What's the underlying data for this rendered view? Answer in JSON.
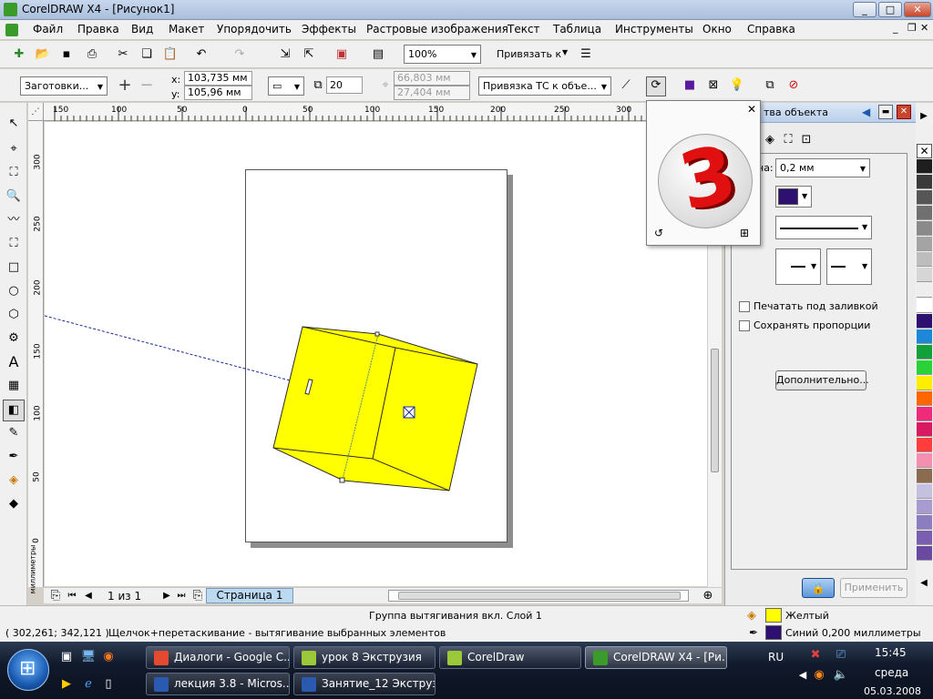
{
  "window": {
    "title": "CorelDRAW X4 - [Рисунок1]",
    "controls": [
      "_",
      "□",
      "✕"
    ]
  },
  "menu": [
    "Файл",
    "Правка",
    "Вид",
    "Макет",
    "Упорядочить",
    "Эффекты",
    "Растровые изображения",
    "Текст",
    "Таблица",
    "Инструменты",
    "Окно",
    "Справка"
  ],
  "toolbar_std": {
    "zoom": "100%",
    "snap_label": "Привязать к"
  },
  "propbar": {
    "presets": "Заготовки...",
    "x_label": "x:",
    "x_value": "103,735 мм",
    "y_label": "y:",
    "y_value": "105,96 мм",
    "depth": "20",
    "vp_x": "66,803 мм",
    "vp_y": "27,404 мм",
    "vp_lock": "Привязка ТС к объе..."
  },
  "ruler": {
    "h_labels": [
      "150",
      "100",
      "50",
      "0",
      "50",
      "100",
      "150",
      "200",
      "250",
      "300"
    ],
    "v_labels": [
      "300",
      "250",
      "200",
      "150",
      "100",
      "50",
      "0"
    ],
    "units": "миллиметры"
  },
  "page_nav": {
    "count": "1 из 1",
    "tab": "Страница 1"
  },
  "docker": {
    "title": "тва объекта",
    "width_label": "на:",
    "width_value": "0,2 мм",
    "color": "#2e1070",
    "checkbox1": "Печатать под заливкой",
    "checkbox2": "Сохранять пропорции",
    "more_button": "Дополнительно...",
    "apply_button": "Применить"
  },
  "palette": [
    "#ffffff",
    "#1e1e1e",
    "#3a3a3a",
    "#565656",
    "#707070",
    "#8a8a8a",
    "#a4a4a4",
    "#bdbdbd",
    "#d6d6d6",
    "#eeeeee",
    "#ffffff",
    "#2e1070",
    "#1e88d8",
    "#11a03a",
    "#2ad23a",
    "#ffee00",
    "#ff6600",
    "#ee2a7b",
    "#d81b60",
    "#ff3d3d",
    "#f48fb1",
    "#8b6b50",
    "#c4c0e0",
    "#a79bd0",
    "#8c7cc0",
    "#7a5fb0",
    "#6a4aa0"
  ],
  "status": {
    "info": "Группа вытягивания вкл. Слой 1",
    "coords": "( 302,261; 342,121 )",
    "hint": "Щелчок+перетаскивание - вытягивание выбранных элементов",
    "fill_name": "Желтый",
    "fill_color": "#ffff00",
    "outline_name": "Синий  0,200 миллиметры",
    "outline_color": "#2e1070"
  },
  "taskbar": {
    "tasks_row1": [
      "Диалоги - Google C...",
      "урок 8  Экструзия",
      "CorelDraw",
      "CorelDRAW X4 - [Ри..."
    ],
    "tasks_row2": [
      "лекция 3.8 - Micros...",
      "Занятие_12 Экструз..."
    ],
    "lang": "RU",
    "time": "15:45",
    "day": "среда",
    "date": "05.03.2008"
  },
  "colors": {
    "extrude_fill": "#ffff00",
    "guide_line": "#1a2a9a"
  }
}
